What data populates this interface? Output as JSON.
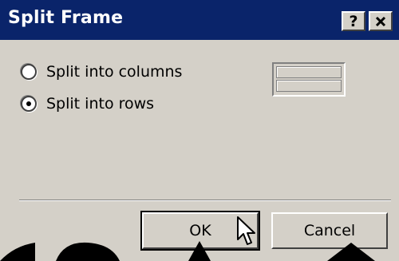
{
  "dialog": {
    "title": "Split Frame",
    "help_label": "?",
    "close_label": "✕"
  },
  "options": [
    {
      "label": "Split into columns",
      "selected": false
    },
    {
      "label": "Split into rows",
      "selected": true
    }
  ],
  "buttons": {
    "ok_label": "OK",
    "cancel_label": "Cancel"
  },
  "colors": {
    "titlebar": "#0a246a",
    "face": "#d4d0c8"
  }
}
